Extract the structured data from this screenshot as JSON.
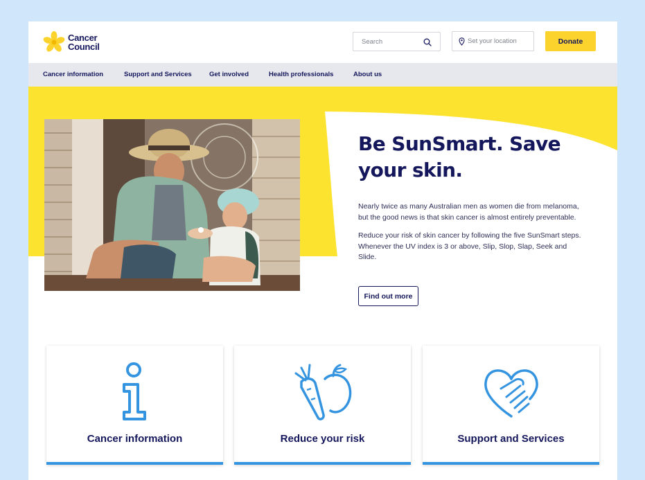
{
  "header": {
    "logo_line1": "Cancer",
    "logo_line2": "Council",
    "search_placeholder": "Search",
    "location_placeholder": "Set your location",
    "donate_label": "Donate"
  },
  "nav": {
    "items": [
      {
        "label": "Cancer information"
      },
      {
        "label": "Support and Services"
      },
      {
        "label": "Get involved"
      },
      {
        "label": "Health professionals"
      },
      {
        "label": "About us"
      }
    ]
  },
  "hero": {
    "title": "Be SunSmart. Save your skin.",
    "paragraph1": "Nearly twice as many Australian men as women die from melanoma, but the good news is that skin cancer is almost entirely preventable.",
    "paragraph2": "Reduce your risk of skin cancer by following the five SunSmart steps. Whenever the UV index is 3 or above, Slip, Slop, Slap, Seek and Slide.",
    "cta_label": "Find out more"
  },
  "cards": [
    {
      "title": "Cancer information",
      "icon": "info-icon"
    },
    {
      "title": "Reduce your risk",
      "icon": "carrot-apple-icon"
    },
    {
      "title": "Support and Services",
      "icon": "heart-handshake-icon"
    }
  ],
  "colors": {
    "brand_navy": "#15175c",
    "brand_yellow": "#fcd32d",
    "accent_blue": "#3594e0",
    "nav_bg": "#e6e8ed",
    "page_bg": "#cfe6fb"
  }
}
